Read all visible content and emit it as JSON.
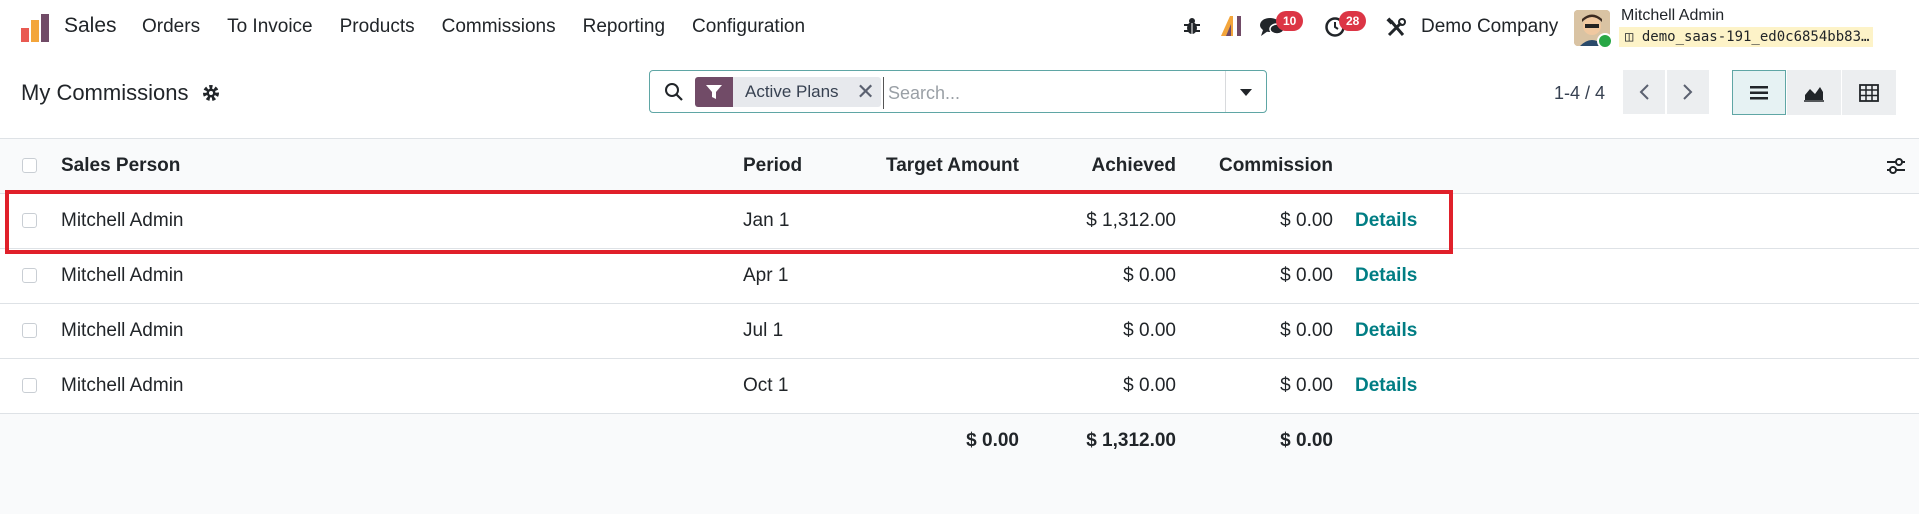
{
  "navbar": {
    "app_name": "Sales",
    "menu": [
      "Orders",
      "To Invoice",
      "Products",
      "Commissions",
      "Reporting",
      "Configuration"
    ],
    "messages_count": "10",
    "activities_count": "28",
    "company": "Demo Company",
    "user_name": "Mitchell Admin",
    "db_name": "demo_saas-191_ed0c6854bb83…"
  },
  "control": {
    "title": "My Commissions",
    "facet_label": "Active Plans",
    "search_placeholder": "Search...",
    "pager": "1-4 / 4"
  },
  "list": {
    "columns": [
      "Sales Person",
      "Period",
      "Target Amount",
      "Achieved",
      "Commission"
    ],
    "rows": [
      {
        "sales_person": "Mitchell Admin",
        "period": "Jan 1",
        "target": "",
        "achieved": "$ 1,312.00",
        "commission": "$ 0.00",
        "action": "Details"
      },
      {
        "sales_person": "Mitchell Admin",
        "period": "Apr 1",
        "target": "",
        "achieved": "$ 0.00",
        "commission": "$ 0.00",
        "action": "Details"
      },
      {
        "sales_person": "Mitchell Admin",
        "period": "Jul 1",
        "target": "",
        "achieved": "$ 0.00",
        "commission": "$ 0.00",
        "action": "Details"
      },
      {
        "sales_person": "Mitchell Admin",
        "period": "Oct 1",
        "target": "",
        "achieved": "$ 0.00",
        "commission": "$ 0.00",
        "action": "Details"
      }
    ],
    "totals": {
      "target": "$ 0.00",
      "achieved": "$ 1,312.00",
      "commission": "$ 0.00"
    }
  },
  "colors": {
    "brand_purple": "#714b67",
    "accent_teal": "#017e84",
    "badge_red": "#dc3545",
    "highlight_red": "#e0202a"
  }
}
